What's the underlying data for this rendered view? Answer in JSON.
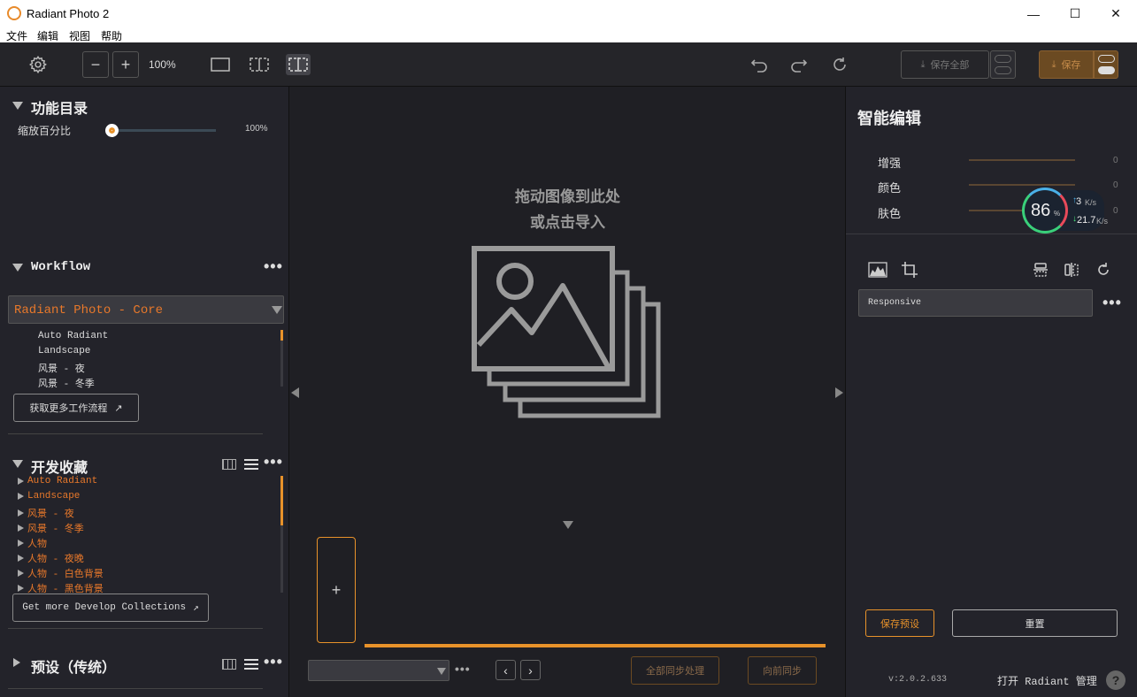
{
  "window": {
    "title": "Radiant Photo 2",
    "minimize": "—",
    "maximize": "☐",
    "close": "✕"
  },
  "menu": [
    "文件",
    "编辑",
    "视图",
    "帮助"
  ],
  "toolbar": {
    "zoom_out": "−",
    "zoom_in": "+",
    "zoom_level": "100%",
    "save_all_label": "保存全部",
    "save_label": "保存",
    "accent": "#e8922a"
  },
  "left": {
    "catalog": {
      "title": "功能目录",
      "zoom_label": "缩放百分比",
      "zoom_value": "100%",
      "zoom_fraction": 0.0
    },
    "workflow": {
      "title": "Workflow",
      "selected": "Radiant Photo - Core",
      "items": [
        "Auto Radiant",
        "Landscape",
        "风景 - 夜",
        "风景 - 冬季"
      ],
      "more_button": "获取更多工作流程"
    },
    "collections": {
      "title": "开发收藏",
      "items": [
        "Auto Radiant",
        "Landscape",
        "风景 - 夜",
        "风景 - 冬季",
        "人物",
        "人物 - 夜晚",
        "人物 - 白色背景",
        "人物 - 黑色背景"
      ],
      "more_button": "Get more Develop Collections"
    },
    "presets": {
      "title": "预设（传统）"
    }
  },
  "center": {
    "drop_line1": "拖动图像到此处",
    "drop_line2": "或点击导入",
    "add_symbol": "+",
    "sync_all_button": "全部同步处理",
    "sync_forward_button": "向前同步"
  },
  "right": {
    "title": "智能编辑",
    "sliders": [
      {
        "label": "增强",
        "value": "0"
      },
      {
        "label": "颜色",
        "value": "0"
      },
      {
        "label": "肤色",
        "value": "0"
      }
    ],
    "monitor": {
      "percent": "86",
      "percent_unit": "%",
      "up": "3",
      "up_unit": "K/s",
      "down": "21.7",
      "down_unit": "K/s"
    },
    "preset_name": "Responsive",
    "save_preset_button": "保存预设",
    "reset_button": "重置",
    "version": "v:2.0.2.633",
    "open_manager": "打开 Radiant 管理",
    "help": "?"
  }
}
